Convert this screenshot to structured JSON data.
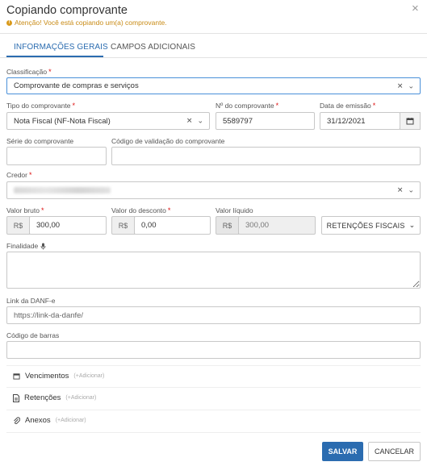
{
  "header": {
    "title": "Copiando comprovante",
    "close_glyph": "×",
    "warning_icon": "!",
    "warning": "Atenção! Você está copiando um(a) comprovante."
  },
  "tabs": [
    {
      "label": "INFORMAÇÕES GERAIS",
      "active": true
    },
    {
      "label": "CAMPOS ADICIONAIS",
      "active": false
    }
  ],
  "form": {
    "classificacao": {
      "label": "Classificação",
      "value": "Comprovante de compras e serviços"
    },
    "tipo": {
      "label": "Tipo do comprovante",
      "value": "Nota Fiscal (NF-Nota Fiscal)"
    },
    "numero": {
      "label": "Nº do comprovante",
      "value": "5589797"
    },
    "data_emissao": {
      "label": "Data de emissão",
      "value": "31/12/2021"
    },
    "serie": {
      "label": "Série do comprovante",
      "value": ""
    },
    "codigo_validacao": {
      "label": "Código de validação do comprovante",
      "value": ""
    },
    "credor": {
      "label": "Credor"
    },
    "valor_bruto": {
      "label": "Valor bruto",
      "prefix": "R$",
      "value": "300,00"
    },
    "valor_desconto": {
      "label": "Valor do desconto",
      "prefix": "R$",
      "value": "0,00"
    },
    "valor_liquido": {
      "label": "Valor líquido",
      "prefix": "R$",
      "value": "300,00"
    },
    "retencoes_button": "RETENÇÕES FISCAIS",
    "finalidade": {
      "label": "Finalidade",
      "value": ""
    },
    "link_danfe": {
      "label": "Link da DANF-e",
      "placeholder": "https://link-da-danfe/"
    },
    "codigo_barras": {
      "label": "Código de barras",
      "value": ""
    },
    "required_mark": "*"
  },
  "sections": [
    {
      "label": "Vencimentos",
      "add": "(+Adicionar)",
      "icon": "calendar-icon"
    },
    {
      "label": "Retenções",
      "add": "(+Adicionar)",
      "icon": "document-icon"
    },
    {
      "label": "Anexos",
      "add": "(+Adicionar)",
      "icon": "paperclip-icon"
    }
  ],
  "footer": {
    "save": "SALVAR",
    "cancel": "CANCELAR"
  },
  "colors": {
    "accent": "#2b6cb0",
    "warning": "#c88a14",
    "required": "#dd1111"
  }
}
